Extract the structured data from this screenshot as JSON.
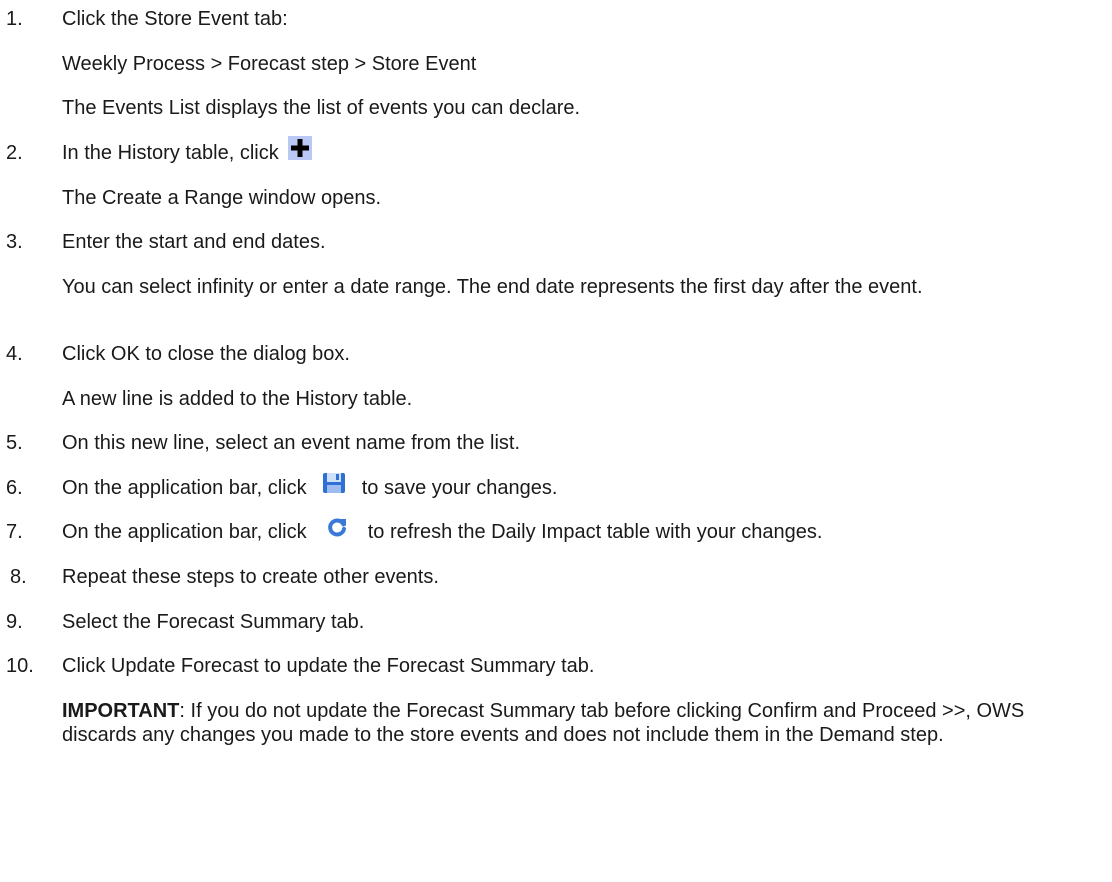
{
  "steps": [
    {
      "number": "1.",
      "text": "Click the Store Event tab:",
      "sub": [
        "Weekly Process > Forecast step > Store Event",
        "The Events List displays the list of events you can declare."
      ]
    },
    {
      "number": "2.",
      "text_before": "In the History table, click",
      "icon": "plus-icon",
      "sub": [
        "The Create a Range window opens."
      ]
    },
    {
      "number": "3.",
      "text": "Enter the start and end dates.",
      "sub_wrapped": "You can select infinity or enter a date range. The end date represents the first day after the event."
    },
    {
      "number": "4.",
      "text": "Click OK to close the dialog box.",
      "sub": [
        "A new line is added to the History table."
      ]
    },
    {
      "number": "5.",
      "text": "On this new line, select an event name from the list."
    },
    {
      "number": "6.",
      "text_before": "On the application bar, click",
      "icon": "save-icon",
      "text_after": "to save your changes."
    },
    {
      "number": "7.",
      "text_before": "On the application bar, click",
      "icon": "refresh-icon",
      "text_after": "to refresh the Daily Impact table with your changes."
    },
    {
      "number": "8.",
      "text": "Repeat these steps to create other events."
    },
    {
      "number": "9.",
      "text": "Select the Forecast Summary tab."
    },
    {
      "number": "10.",
      "text": "Click Update Forecast to update the Forecast Summary tab.",
      "important_label": "IMPORTANT",
      "important_text": ": If you do not update the Forecast Summary tab before clicking Confirm and Proceed >>, OWS discards any changes you made to the store events and does not include them in the Demand step."
    }
  ],
  "colors": {
    "text": "#1a1a1a",
    "icon_bg": "#b9c8f5",
    "save_blue": "#2f6fd6",
    "refresh_blue": "#3b79d8"
  }
}
